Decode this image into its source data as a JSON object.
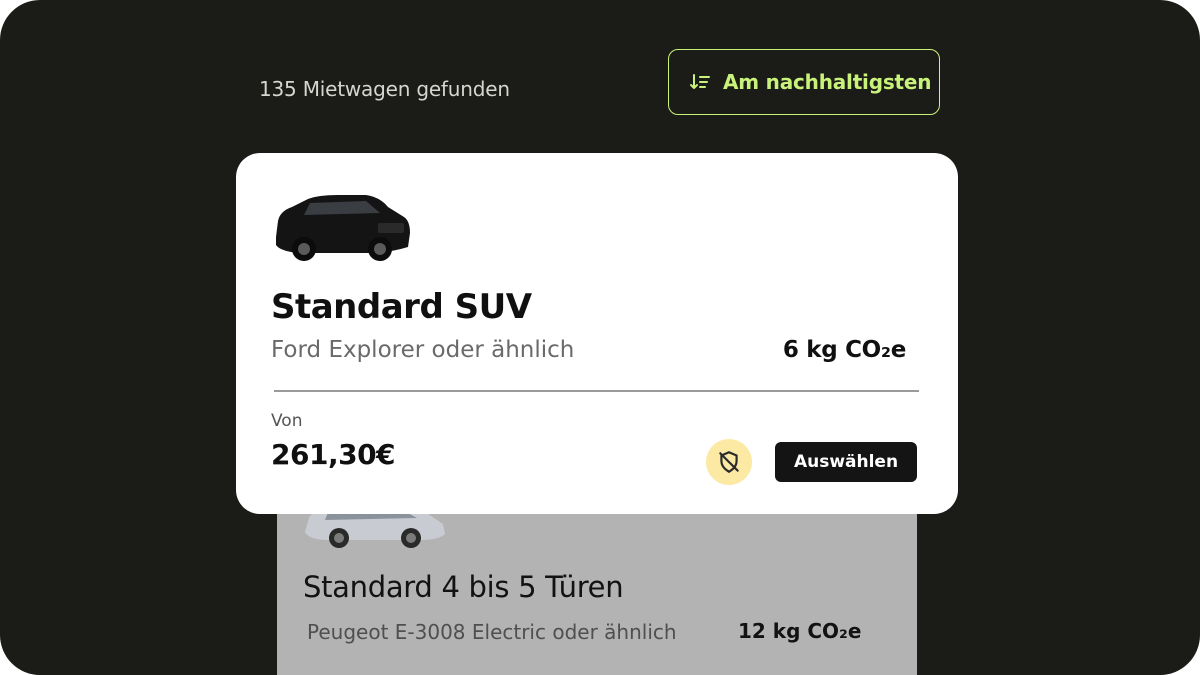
{
  "results": {
    "count_text": "135 Mietwagen gefunden"
  },
  "sort": {
    "label": "Am nachhaltigsten",
    "icon": "sort-icon",
    "accent_color": "#c9f27a"
  },
  "cards": [
    {
      "image": "black-suv-car-image",
      "title": "Standard SUV",
      "subtitle": "Ford Explorer oder ähnlich",
      "co2": "6 kg CO₂e",
      "price_label": "Von",
      "price": "261,30€",
      "badge_icon": "shield-off-icon",
      "badge_color": "#fbe9a4",
      "select_label": "Auswählen"
    },
    {
      "image": "grey-compact-car-image",
      "title": "Standard 4 bis 5 Türen",
      "subtitle": "Peugeot E-3008 Electric oder ähnlich",
      "co2": "12 kg CO₂e"
    }
  ],
  "colors": {
    "background": "#1b1b17",
    "card": "#ffffff",
    "button": "#141414"
  }
}
